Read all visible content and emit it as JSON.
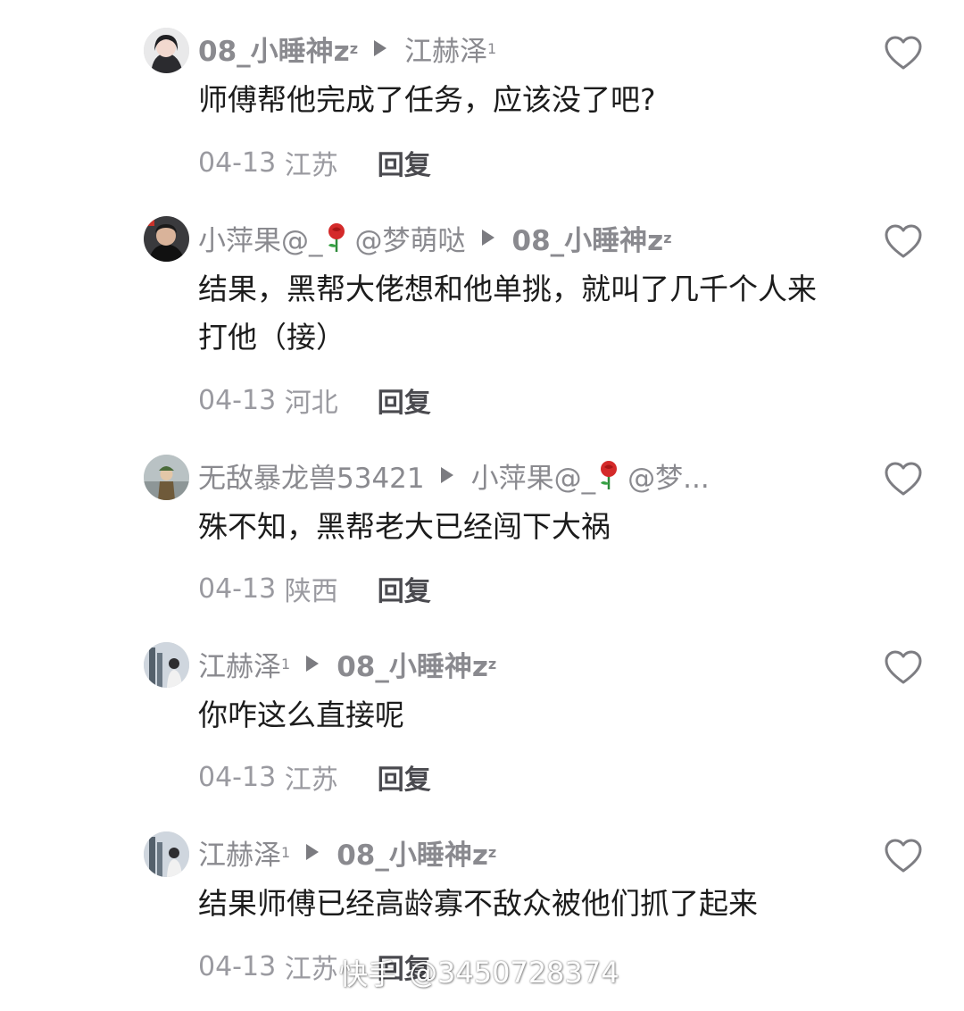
{
  "comments": [
    {
      "author": "08_小睡神z",
      "author_sup": "z",
      "reply_to": "江赫泽",
      "reply_to_sup": "1",
      "text": "师傅帮他完成了任务，应该没了吧?",
      "date": "04-13",
      "location": "江苏",
      "reply_label": "回复"
    },
    {
      "author": "小萍果@_",
      "author_suffix": "@梦萌哒",
      "reply_to": "08_小睡神z",
      "reply_to_sup": "z",
      "text": "结果，黑帮大佬想和他单挑，就叫了几千个人来打他（接）",
      "date": "04-13",
      "location": "河北",
      "reply_label": "回复"
    },
    {
      "author": "无敌暴龙兽53421",
      "reply_to": "小萍果@_",
      "reply_to_suffix": "@梦...",
      "text": "殊不知，黑帮老大已经闯下大祸",
      "date": "04-13",
      "location": "陕西",
      "reply_label": "回复"
    },
    {
      "author": "江赫泽",
      "author_sup": "1",
      "reply_to": "08_小睡神z",
      "reply_to_sup": "z",
      "text": "你咋这么直接呢",
      "date": "04-13",
      "location": "江苏",
      "reply_label": "回复"
    },
    {
      "author": "江赫泽",
      "author_sup": "1",
      "reply_to": "08_小睡神z",
      "reply_to_sup": "z",
      "text": "结果师傅已经高龄寡不敌众被他们抓了起来",
      "date": "04-13",
      "location": "江苏",
      "reply_label": "回复"
    }
  ],
  "watermark": {
    "brand": "快手",
    "handle": "@3450728374"
  },
  "icons": {
    "like": "heart-outline-icon",
    "reply_arrow": "play-triangle-icon",
    "emoji": "rose-emoji-icon"
  },
  "colors": {
    "name": "#8a8a8f",
    "text": "#1c1c1c",
    "meta": "#9a9aa0",
    "reply": "#4a4a4f",
    "heart": "#7d7d82"
  }
}
